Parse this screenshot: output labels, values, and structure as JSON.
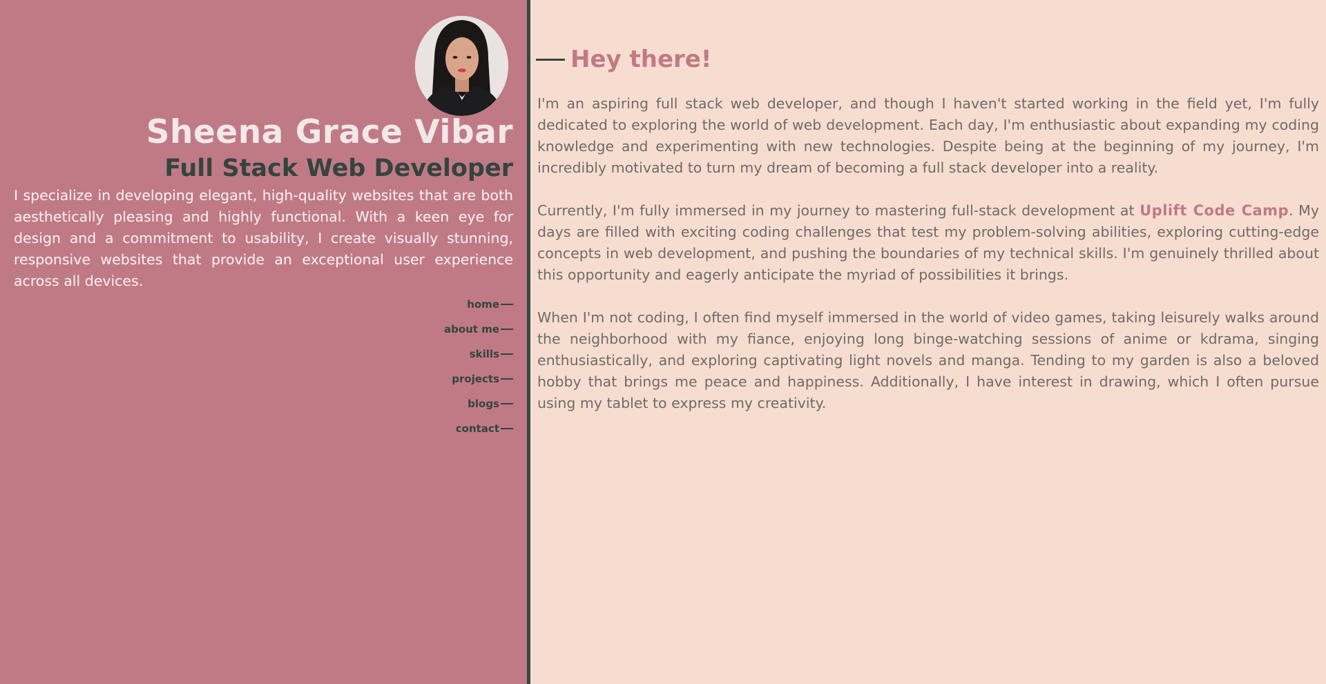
{
  "profile": {
    "name": "Sheena Grace Vibar",
    "role": "Full Stack Web Developer",
    "intro": "I specialize in developing elegant, high-quality websites that are both aesthetically pleasing and highly functional. With a keen eye for design and a commitment to usability, I create visually stunning, responsive websites that provide an exceptional user experience across all devices."
  },
  "nav": {
    "items": [
      {
        "label": "home"
      },
      {
        "label": "about me"
      },
      {
        "label": "skills"
      },
      {
        "label": "projects"
      },
      {
        "label": "blogs"
      },
      {
        "label": "contact"
      }
    ]
  },
  "about": {
    "heading": "Hey there!",
    "p1": "I'm an aspiring full stack web developer, and though I haven't started working in the field yet, I'm fully dedicated to exploring the world of web development. Each day, I'm enthusiastic about expanding my coding knowledge and experimenting with new technologies. Despite being at the beginning of my journey, I'm incredibly motivated to turn my dream of becoming a full stack developer into a reality.",
    "p2_before": "Currently, I'm fully immersed in my journey to mastering full-stack development at ",
    "p2_link": "Uplift Code Camp",
    "p2_after": ". My days are filled with exciting coding challenges that test my problem-solving abilities, exploring cutting-edge concepts in web development, and pushing the boundaries of my technical skills. I'm genuinely thrilled about this opportunity and eagerly anticipate the myriad of possibilities it brings.",
    "p3": "When I'm not coding, I often find myself immersed in the world of video games, taking leisurely walks around the neighborhood with my fiance, enjoying long binge-watching sessions of anime or kdrama, singing enthusiastically, and exploring captivating light novels and manga. Tending to my garden is also a beloved hobby that brings me peace and happiness. Additionally, I have interest in drawing, which I often pursue using my tablet to express my creativity."
  },
  "colors": {
    "sidebar_bg": "#c07a86",
    "main_bg": "#f7ddd0",
    "divider": "#354842",
    "accent": "#c07a86",
    "dark_text": "#34443e",
    "body_text": "#6f6a68"
  }
}
